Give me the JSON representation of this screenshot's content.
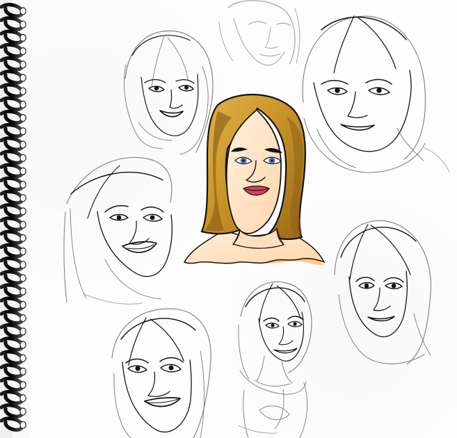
{
  "scene": {
    "subject": "",
    "palette": {
      "paper": "#fdfdfd",
      "pencil": "#111111",
      "pencil_light": "#858585",
      "spiral": "#111111",
      "hair": "#c99528",
      "hair_shadow": "#8c5f15",
      "skin": "#ffe0bd",
      "shoulder": "#ffc98d",
      "eye_blue": "#4f6fbf",
      "lip": "#d94155"
    },
    "elements": [
      "spiral-binding",
      "center-colored-portrait",
      "pencil-sketches"
    ]
  }
}
